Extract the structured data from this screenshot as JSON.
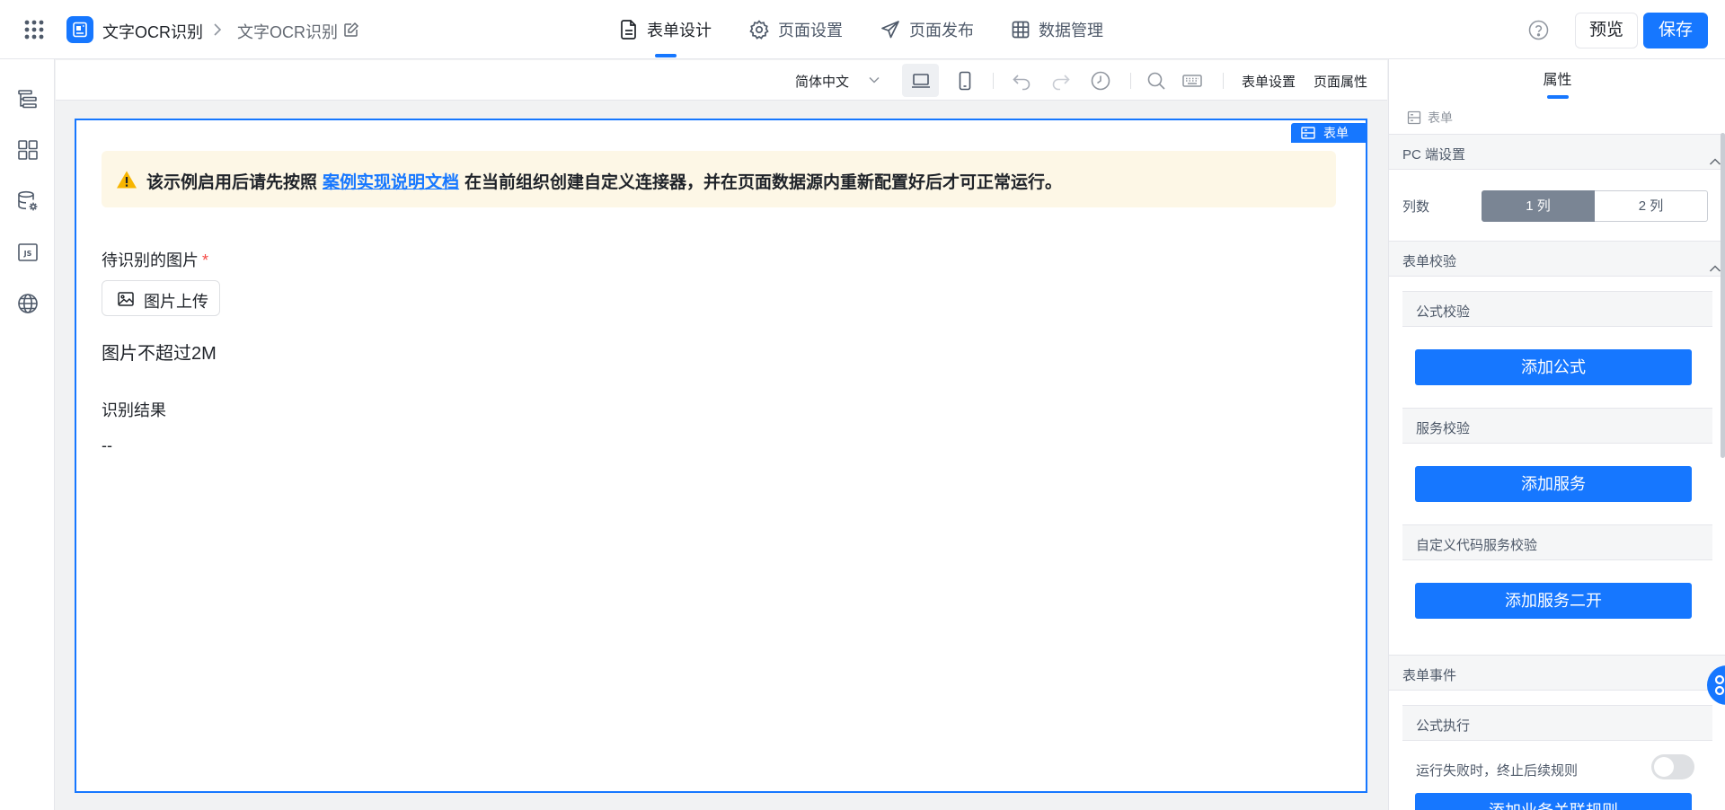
{
  "header": {
    "app_name": "文字OCR识别",
    "page_name": "文字OCR识别",
    "tabs": [
      {
        "label": "表单设计",
        "icon": "document-icon",
        "active": true
      },
      {
        "label": "页面设置",
        "icon": "gear-icon",
        "active": false
      },
      {
        "label": "页面发布",
        "icon": "send-icon",
        "active": false
      },
      {
        "label": "数据管理",
        "icon": "table-grid-icon",
        "active": false
      }
    ],
    "preview_label": "预览",
    "save_label": "保存"
  },
  "sidebar": {
    "icons": [
      "outline-tree-icon",
      "components-grid-icon",
      "datasource-gear-icon",
      "js-code-icon",
      "globe-icon"
    ]
  },
  "toolbar": {
    "language": "简体中文",
    "form_settings": "表单设置",
    "page_properties": "页面属性"
  },
  "canvas": {
    "form_tag": "表单",
    "notice": {
      "prefix": "该示例启用后请先按照",
      "link_text": "案例实现说明文档",
      "suffix": "在当前组织创建自定义连接器，并在页面数据源内重新配置好后才可正常运行。"
    },
    "image_field": {
      "label": "待识别的图片",
      "required_mark": "*",
      "upload_label": "图片上传"
    },
    "hint": "图片不超过2M",
    "result_field": {
      "label": "识别结果",
      "value": "--"
    }
  },
  "panel": {
    "tab": "属性",
    "crumb": "表单",
    "pc_section": "PC 端设置",
    "columns_label": "列数",
    "column_options": [
      "1 列",
      "2 列"
    ],
    "selected_columns": "1 列",
    "validation_section": "表单校验",
    "formula_validation": "公式校验",
    "add_formula": "添加公式",
    "service_validation": "服务校验",
    "add_service": "添加服务",
    "custom_code_validation": "自定义代码服务校验",
    "add_service_dev": "添加服务二开",
    "events_section": "表单事件",
    "formula_execution": "公式执行",
    "stop_on_fail_label": "运行失败时，终止后续规则",
    "stop_on_fail": false,
    "add_business_rule": "添加业务关联规则"
  },
  "colors": {
    "primary": "#1677ff",
    "notice_bg": "#fdf7e6",
    "segment_active": "#7a8594",
    "required": "#f54a45",
    "warning": "#f7b500"
  }
}
